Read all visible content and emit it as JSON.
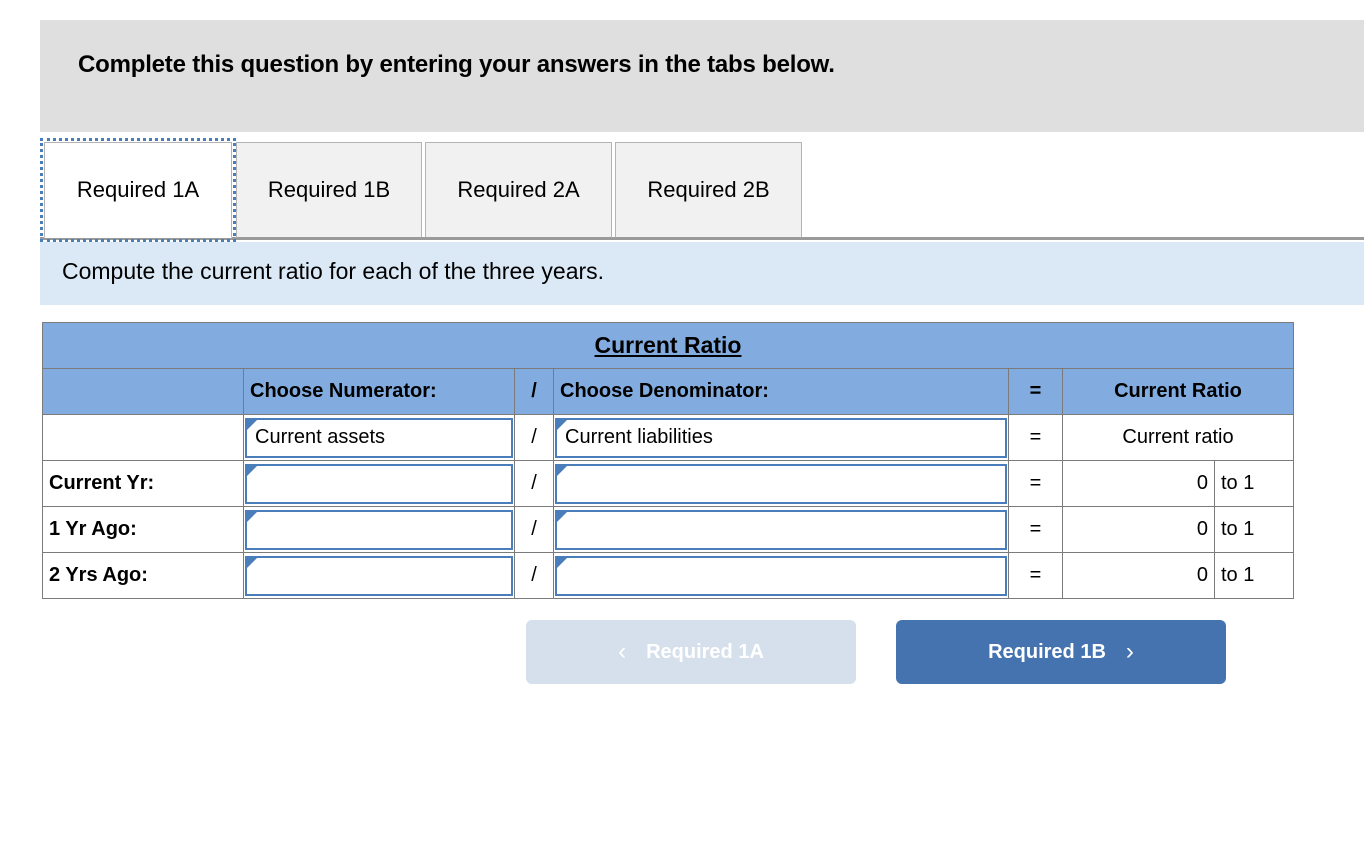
{
  "header": {
    "instruction": "Complete this question by entering your answers in the tabs below."
  },
  "tabs": {
    "items": [
      {
        "label": "Required 1A",
        "active": true
      },
      {
        "label": "Required 1B",
        "active": false
      },
      {
        "label": "Required 2A",
        "active": false
      },
      {
        "label": "Required 2B",
        "active": false
      }
    ]
  },
  "requirement": {
    "text": "Compute the current ratio for each of the three years."
  },
  "table": {
    "title": "Current Ratio",
    "columns": {
      "label": "",
      "numerator": "Choose Numerator:",
      "slash": "/",
      "denominator": "Choose Denominator:",
      "equals": "=",
      "ratio": "Current Ratio"
    },
    "formula_row": {
      "label": "",
      "numerator": "Current assets",
      "slash": "/",
      "denominator": "Current liabilities",
      "equals": "=",
      "result": "Current ratio"
    },
    "rows": [
      {
        "label": "Current Yr:",
        "numerator": "",
        "slash": "/",
        "denominator": "",
        "equals": "=",
        "value": "0",
        "unit": "to 1"
      },
      {
        "label": "1 Yr Ago:",
        "numerator": "",
        "slash": "/",
        "denominator": "",
        "equals": "=",
        "value": "0",
        "unit": "to 1"
      },
      {
        "label": "2 Yrs Ago:",
        "numerator": "",
        "slash": "/",
        "denominator": "",
        "equals": "=",
        "value": "0",
        "unit": "to 1"
      }
    ]
  },
  "navigation": {
    "prev_label": "Required 1A",
    "prev_icon": "chevron-left-icon",
    "next_label": "Required 1B",
    "next_icon": "chevron-right-icon",
    "prev_chevron": "‹",
    "next_chevron": "›"
  },
  "colors": {
    "header_gray": "#dfdfdf",
    "banner_blue": "#dbe9f7",
    "table_header_blue": "#82ace0",
    "select_border_blue": "#4a7ebb",
    "next_button_blue": "#4573b0",
    "prev_button_blue": "#d6dfec"
  }
}
